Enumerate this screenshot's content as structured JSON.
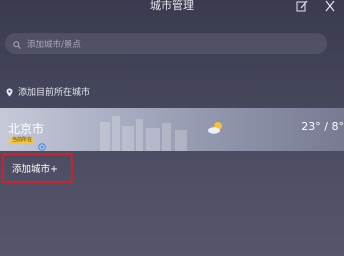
{
  "header": {
    "title": "城市管理",
    "edit_icon": "edit-icon",
    "close_icon": "close-icon"
  },
  "search": {
    "placeholder": "添加城市/景点",
    "icon": "search-icon"
  },
  "locate": {
    "label": "添加目前所在城市",
    "icon": "location-pin-icon"
  },
  "cities": [
    {
      "name": "北京市",
      "badge": "当前所在",
      "temperature": "23° / 8°",
      "weather_icon": "partly-cloudy-icon"
    }
  ],
  "add_city": {
    "label": "添加城市+"
  },
  "colors": {
    "highlight_border": "#d0222a",
    "badge_bg": "#f3c63c"
  }
}
